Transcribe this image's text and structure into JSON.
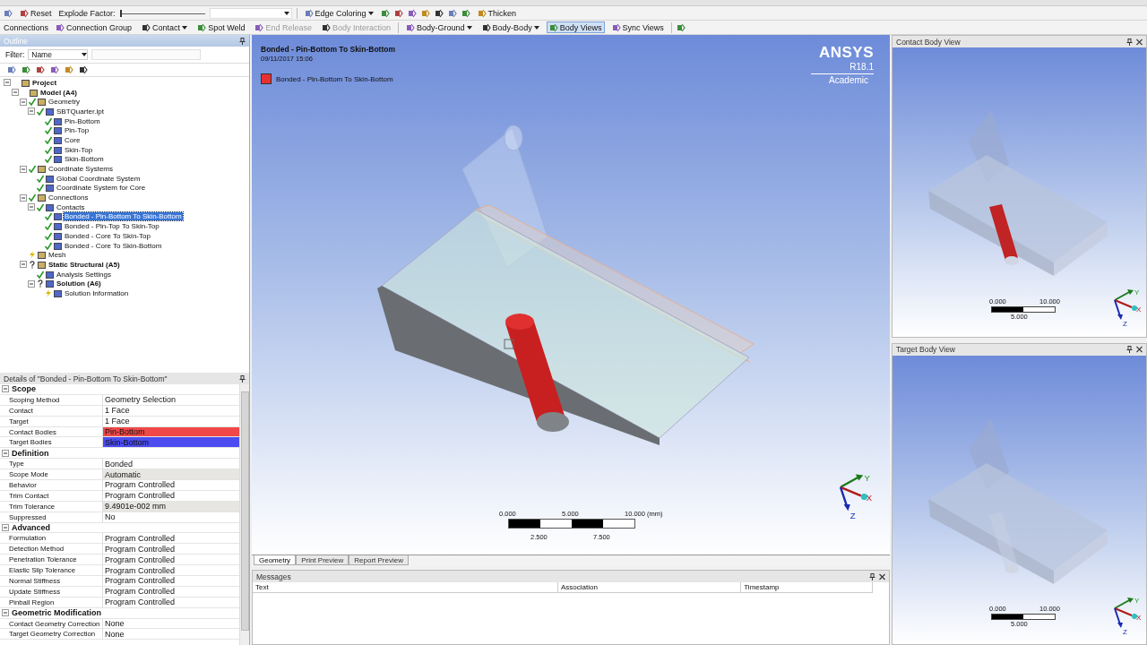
{
  "toolbar_rows": [
    [
      {
        "kind": "icon"
      },
      {
        "kind": "button",
        "label": "Reset",
        "disabled": false,
        "selected": false,
        "caret": false
      },
      {
        "kind": "label",
        "label": "Explode Factor:"
      },
      {
        "kind": "slider",
        "level": 0
      },
      {
        "kind": "select"
      },
      {
        "kind": "separator"
      },
      {
        "kind": "button",
        "label": "Edge Coloring",
        "disabled": false,
        "selected": false,
        "caret": true
      },
      {
        "kind": "icon"
      },
      {
        "kind": "icon"
      },
      {
        "kind": "icon"
      },
      {
        "kind": "icon"
      },
      {
        "kind": "icon"
      },
      {
        "kind": "icon"
      },
      {
        "kind": "icon"
      },
      {
        "kind": "button",
        "label": "Thicken",
        "disabled": false,
        "selected": false,
        "caret": false
      }
    ],
    [
      {
        "kind": "label",
        "label": "Connections"
      },
      {
        "kind": "button",
        "label": "Connection Group",
        "disabled": false,
        "selected": false,
        "caret": false
      },
      {
        "kind": "button",
        "label": "Contact",
        "disabled": false,
        "selected": false,
        "caret": true
      },
      {
        "kind": "button",
        "label": "Spot Weld",
        "disabled": false,
        "selected": false,
        "caret": false
      },
      {
        "kind": "button",
        "label": "End Release",
        "disabled": true,
        "selected": false,
        "caret": false
      },
      {
        "kind": "button",
        "label": "Body Interaction",
        "disabled": true,
        "selected": false,
        "caret": false
      },
      {
        "kind": "separator"
      },
      {
        "kind": "button",
        "label": "Body-Ground",
        "disabled": false,
        "selected": false,
        "caret": true
      },
      {
        "kind": "button",
        "label": "Body-Body",
        "disabled": false,
        "selected": false,
        "caret": true
      },
      {
        "kind": "button",
        "label": "Body Views",
        "disabled": false,
        "selected": true,
        "caret": false
      },
      {
        "kind": "button",
        "label": "Sync Views",
        "disabled": false,
        "selected": false,
        "caret": false
      },
      {
        "kind": "separator"
      },
      {
        "kind": "icon"
      }
    ]
  ],
  "outline": {
    "title": "Outline",
    "filter_label": "Filter:",
    "filter_value": "Name",
    "tree": [
      {
        "label": "Project",
        "bold": true,
        "selected": false,
        "expanded": true,
        "children": [
          {
            "label": "Model (A4)",
            "bold": true,
            "selected": false,
            "expanded": true,
            "children": [
              {
                "label": "Geometry",
                "bold": false,
                "kind": "ok",
                "selected": false,
                "expanded": true,
                "children": [
                  {
                    "label": "SBTQuarter.ipt",
                    "bold": false,
                    "kind": "ok",
                    "selected": false,
                    "expanded": true,
                    "children": [
                      {
                        "label": "Pin-Bottom",
                        "bold": false,
                        "kind": "ok",
                        "selected": false
                      },
                      {
                        "label": "Pin-Top",
                        "bold": false,
                        "kind": "ok",
                        "selected": false
                      },
                      {
                        "label": "Core",
                        "bold": false,
                        "kind": "ok",
                        "selected": false
                      },
                      {
                        "label": "Skin-Top",
                        "bold": false,
                        "kind": "ok",
                        "selected": false
                      },
                      {
                        "label": "Skin-Bottom",
                        "bold": false,
                        "kind": "ok",
                        "selected": false
                      }
                    ]
                  }
                ]
              },
              {
                "label": "Coordinate Systems",
                "bold": false,
                "kind": "ok",
                "selected": false,
                "expanded": true,
                "children": [
                  {
                    "label": "Global Coordinate System",
                    "bold": false,
                    "kind": "ok",
                    "selected": false
                  },
                  {
                    "label": "Coordinate System for Core",
                    "bold": false,
                    "kind": "ok",
                    "selected": false
                  }
                ]
              },
              {
                "label": "Connections",
                "bold": false,
                "kind": "ok",
                "selected": false,
                "expanded": true,
                "children": [
                  {
                    "label": "Contacts",
                    "bold": false,
                    "kind": "ok",
                    "selected": false,
                    "expanded": true,
                    "children": [
                      {
                        "label": "Bonded - Pin-Bottom To Skin-Bottom",
                        "bold": false,
                        "kind": "ok",
                        "selected": true
                      },
                      {
                        "label": "Bonded - Pin-Top To Skin-Top",
                        "bold": false,
                        "kind": "ok",
                        "selected": false
                      },
                      {
                        "label": "Bonded - Core To Skin-Top",
                        "bold": false,
                        "kind": "ok",
                        "selected": false
                      },
                      {
                        "label": "Bonded - Core To Skin-Bottom",
                        "bold": false,
                        "kind": "ok",
                        "selected": false
                      }
                    ]
                  }
                ]
              },
              {
                "label": "Mesh",
                "bold": false,
                "kind": "lightning",
                "selected": false
              },
              {
                "label": "Static Structural (A5)",
                "bold": true,
                "kind": "question",
                "selected": false,
                "expanded": true,
                "children": [
                  {
                    "label": "Analysis Settings",
                    "bold": false,
                    "kind": "ok",
                    "selected": false
                  },
                  {
                    "label": "Solution (A6)",
                    "bold": true,
                    "kind": "question",
                    "selected": false,
                    "expanded": true,
                    "children": [
                      {
                        "label": "Solution Information",
                        "bold": false,
                        "kind": "lightning",
                        "selected": false
                      }
                    ]
                  }
                ]
              }
            ]
          }
        ]
      }
    ]
  },
  "details": {
    "title": "Details of \"Bonded - Pin-Bottom To Skin-Bottom\"",
    "groups": [
      {
        "name": "Scope",
        "expanded": true,
        "rows": [
          {
            "name": "Scoping Method",
            "value": "Geometry Selection",
            "kind": "normal"
          },
          {
            "name": "Contact",
            "value": "1 Face",
            "kind": "normal"
          },
          {
            "name": "Target",
            "value": "1 Face",
            "kind": "normal"
          },
          {
            "name": "Contact Bodies",
            "value": "Pin-Bottom",
            "kind": "color",
            "color": "#f04848"
          },
          {
            "name": "Target Bodies",
            "value": "Skin-Bottom",
            "kind": "color",
            "color": "#4c4cf0"
          }
        ]
      },
      {
        "name": "Definition",
        "expanded": true,
        "rows": [
          {
            "name": "Type",
            "value": "Bonded",
            "kind": "normal"
          },
          {
            "name": "Scope Mode",
            "value": "Automatic",
            "kind": "shaded"
          },
          {
            "name": "Behavior",
            "value": "Program Controlled",
            "kind": "normal"
          },
          {
            "name": "Trim Contact",
            "value": "Program Controlled",
            "kind": "normal"
          },
          {
            "name": "Trim Tolerance",
            "value": "9.4901e-002 mm",
            "kind": "shaded"
          },
          {
            "name": "Suppressed",
            "value": "No",
            "kind": "normal"
          }
        ]
      },
      {
        "name": "Advanced",
        "expanded": true,
        "rows": [
          {
            "name": "Formulation",
            "value": "Program Controlled",
            "kind": "normal"
          },
          {
            "name": "Detection Method",
            "value": "Program Controlled",
            "kind": "normal"
          },
          {
            "name": "Penetration Tolerance",
            "value": "Program Controlled",
            "kind": "normal"
          },
          {
            "name": "Elastic Slip Tolerance",
            "value": "Program Controlled",
            "kind": "normal"
          },
          {
            "name": "Normal Stiffness",
            "value": "Program Controlled",
            "kind": "normal"
          },
          {
            "name": "Update Stiffness",
            "value": "Program Controlled",
            "kind": "normal"
          },
          {
            "name": "Pinball Region",
            "value": "Program Controlled",
            "kind": "normal"
          }
        ]
      },
      {
        "name": "Geometric Modification",
        "expanded": true,
        "rows": [
          {
            "name": "Contact Geometry Correction",
            "value": "None",
            "kind": "normal"
          },
          {
            "name": "Target Geometry Correction",
            "value": "None",
            "kind": "normal"
          }
        ]
      }
    ]
  },
  "viewport": {
    "title": "Bonded - Pin-Bottom To Skin-Bottom",
    "date": "09/11/2017 15:06",
    "legend": [
      {
        "label": "Bonded - Pin-Bottom To Skin-Bottom",
        "color": "#e83030"
      }
    ],
    "logo": {
      "brand": "ANSYS",
      "version": "R18.1",
      "edition": "Academic"
    },
    "scale": {
      "top_labels": [
        "0.000",
        "5.000",
        "10.000 (mm)"
      ],
      "bottom_labels": [
        "2.500",
        "7.500"
      ]
    },
    "axes": {
      "x": "X",
      "y": "Y",
      "z": "Z"
    }
  },
  "view_tabs": [
    {
      "label": "Geometry",
      "selected": true
    },
    {
      "label": "Print Preview",
      "selected": false
    },
    {
      "label": "Report Preview",
      "selected": false
    }
  ],
  "messages": {
    "title": "Messages",
    "columns": [
      "Text",
      "Association",
      "Timestamp"
    ]
  },
  "side_views": [
    {
      "title": "Contact Body View",
      "pin_highlighted": true,
      "scale": [
        "0.000",
        "10.000",
        "5.000"
      ],
      "axes": {
        "x": "X",
        "y": "Y",
        "z": "Z"
      }
    },
    {
      "title": "Target Body View",
      "pin_highlighted": false,
      "scale": [
        "0.000",
        "10.000",
        "5.000"
      ],
      "axes": {
        "x": "X",
        "y": "Y",
        "z": "Z"
      }
    }
  ]
}
